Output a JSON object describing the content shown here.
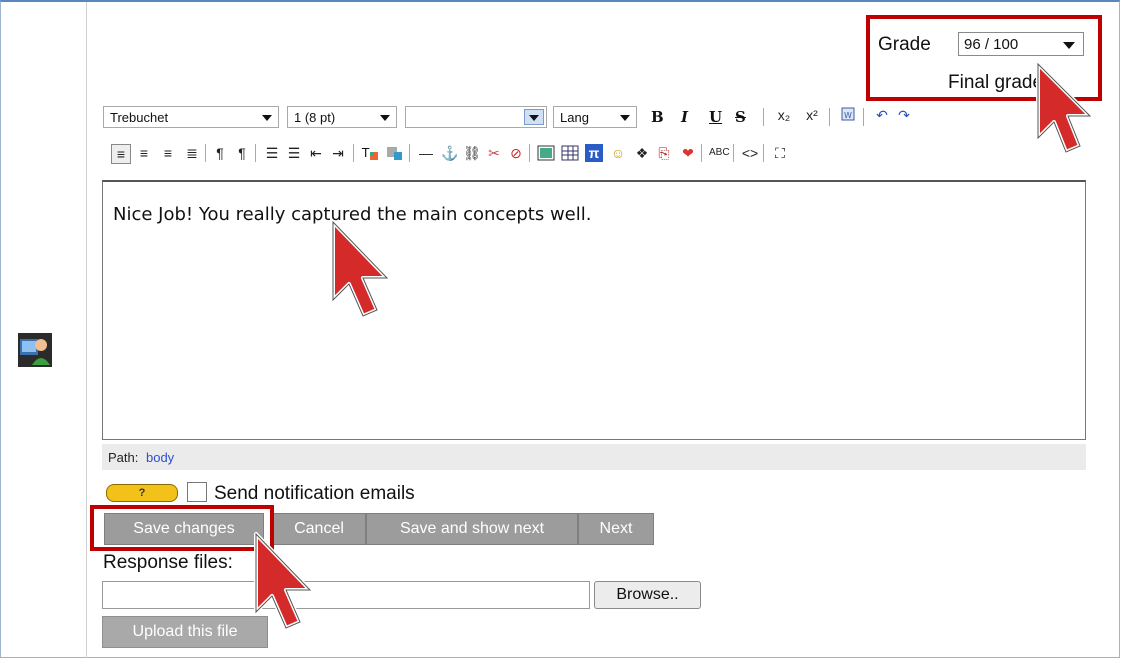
{
  "grade": {
    "label": "Grade",
    "selected": "96 / 100",
    "final_label": "Final grade: -"
  },
  "editor_toolbar": {
    "font_family": "Trebuchet",
    "font_size": "1 (8 pt)",
    "format": "",
    "lang": "Lang",
    "bold": "B",
    "italic": "I",
    "underline": "U",
    "strike": "S"
  },
  "editor": {
    "content": "Nice Job! You really captured the main concepts well."
  },
  "path": {
    "label": "Path:",
    "value": "body"
  },
  "help_icon_text": "?",
  "notification": {
    "label": "Send notification emails"
  },
  "buttons": {
    "save": "Save changes",
    "cancel": "Cancel",
    "save_next": "Save and show next",
    "next": "Next"
  },
  "response_files": {
    "label": "Response files:",
    "browse": "Browse..",
    "upload": "Upload this file"
  },
  "colors": {
    "highlight": "#c00000",
    "cursor_red": "#d42a2a",
    "button_gray": "#9c9c9c"
  }
}
